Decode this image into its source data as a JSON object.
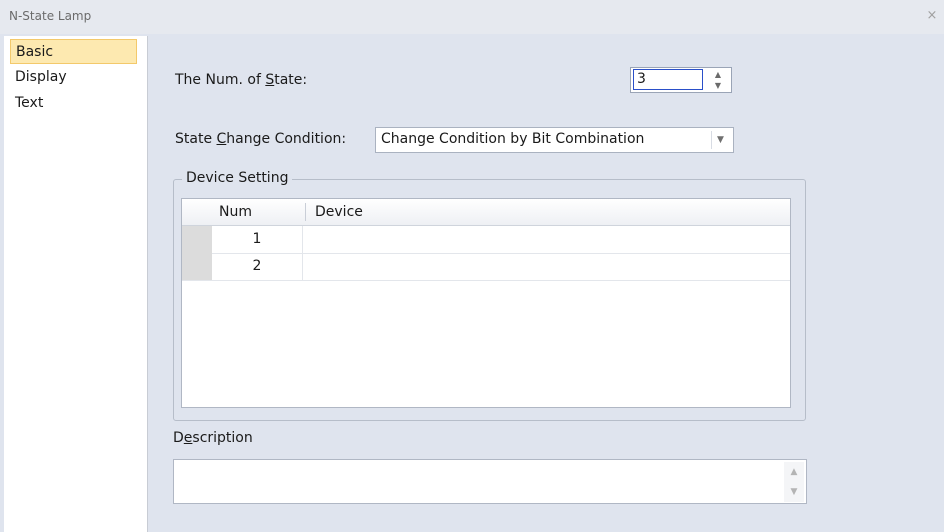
{
  "window": {
    "title": "N-State Lamp",
    "close_glyph": "×"
  },
  "sidebar": {
    "items": [
      {
        "label": "Basic",
        "active": true
      },
      {
        "label": "Display",
        "active": false
      },
      {
        "label": "Text",
        "active": false
      }
    ]
  },
  "basic": {
    "num_states_label_pre": "The Num. of ",
    "num_states_label_u": "S",
    "num_states_label_post": "tate:",
    "num_states_value": "3",
    "state_change_label_pre": "State ",
    "state_change_label_u": "C",
    "state_change_label_post": "hange Condition:",
    "state_change_value": "Change Condition by Bit Combination",
    "device_group_title": "Device Setting",
    "grid": {
      "columns": [
        "Num",
        "Device"
      ],
      "rows": [
        {
          "num": "1",
          "device": ""
        },
        {
          "num": "2",
          "device": ""
        }
      ]
    },
    "description_label_pre": "D",
    "description_label_u": "e",
    "description_label_post": "scription",
    "description_value": ""
  },
  "icons": {
    "spin_up": "▲",
    "spin_down": "▼",
    "dropdown": "▼",
    "scroll_up": "▲",
    "scroll_down": "▼"
  },
  "colors": {
    "background": "#dfe4ee",
    "active_item": "#fde9b0",
    "focus_border": "#2a4fc9"
  }
}
